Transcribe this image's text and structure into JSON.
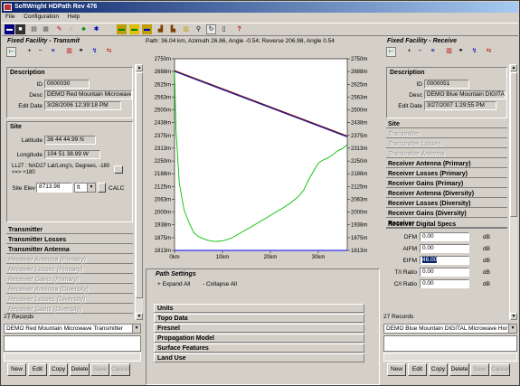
{
  "app": {
    "title": "SoftWright HDPath Rev 476"
  },
  "menu": [
    "File",
    "Configuration",
    "Help"
  ],
  "toolbar": {
    "icons": [
      "save-icon",
      "disk-icon",
      "print-icon",
      "report-icon",
      "edit-icon",
      "draw-icon",
      "chart-icon",
      "globe-icon",
      "map-icon",
      "map2-icon",
      "map3-icon",
      "terrain-icon",
      "zoom-icon",
      "refresh-icon",
      "copy-icon",
      "help-icon"
    ]
  },
  "left": {
    "panel_title": "Fixed Facility - Transmit",
    "description": {
      "header": "Description",
      "id_label": "ID",
      "id_value": "0000030",
      "desc_label": "Desc",
      "desc_value": "DEMO Red Mountain Microwave",
      "date_label": "Edit Date",
      "date_value": "3/28/2006 12:39:18 PM"
    },
    "site": {
      "header": "Site",
      "lat_label": "Latitude",
      "lat_value": "38 44 44.99 N",
      "lon_label": "Longitude",
      "lon_value": "104 51 38.99 W",
      "datum_text": "LL27 : NAD27 Lat/Long's, Degrees, -180 <=> +180",
      "elev_label": "Site Elev",
      "elev_value": "8713.98",
      "elev_unit": "ft",
      "calc_label": "CALC"
    },
    "sections": [
      {
        "label": "Transmitter",
        "enabled": true
      },
      {
        "label": "Transmitter Losses",
        "enabled": true
      },
      {
        "label": "Transmitter Antenna",
        "enabled": true
      },
      {
        "label": "Receiver Antenna (Primary)",
        "enabled": false
      },
      {
        "label": "Receiver Losses (Primary)",
        "enabled": false
      },
      {
        "label": "Receiver Gains (Primary)",
        "enabled": false
      },
      {
        "label": "Receiver Antenna (Diversity)",
        "enabled": false
      },
      {
        "label": "Receiver Losses (Diversity)",
        "enabled": false
      },
      {
        "label": "Receiver Gains (Diversity)",
        "enabled": false
      },
      {
        "label": "Receiver",
        "enabled": false
      },
      {
        "label": "Receiver Digital Specs",
        "enabled": false
      }
    ],
    "records_label": "27 Records",
    "selected_record": "DEMO Red Mountain Microwave Transmitter",
    "buttons": [
      {
        "label": "New",
        "enabled": true
      },
      {
        "label": "Edit",
        "enabled": true
      },
      {
        "label": "Copy",
        "enabled": true
      },
      {
        "label": "Delete",
        "enabled": true
      },
      {
        "label": "Save",
        "enabled": false
      },
      {
        "label": "Cancel",
        "enabled": false
      }
    ]
  },
  "right": {
    "panel_title": "Fixed Facility - Receive",
    "description": {
      "header": "Description",
      "id_label": "ID",
      "id_value": "0000051",
      "desc_label": "Desc",
      "desc_value": "DEMO Blue Mountain DIGITAL",
      "date_label": "Edit Date",
      "date_value": "3/27/2007 1:29:55 PM"
    },
    "site_header": "Site",
    "sections": [
      {
        "label": "Transmitter",
        "enabled": false
      },
      {
        "label": "Transmitter Losses",
        "enabled": false
      },
      {
        "label": "Transmitter Antenna",
        "enabled": false
      },
      {
        "label": "Receiver Antenna (Primary)",
        "enabled": true
      },
      {
        "label": "Receiver Losses (Primary)",
        "enabled": true
      },
      {
        "label": "Receiver Gains (Primary)",
        "enabled": true
      },
      {
        "label": "Receiver Antenna (Diversity)",
        "enabled": true
      },
      {
        "label": "Receiver Losses (Diversity)",
        "enabled": true
      },
      {
        "label": "Receiver Gains (Diversity)",
        "enabled": true
      },
      {
        "label": "Receiver",
        "enabled": true
      }
    ],
    "digital": {
      "header": "Receiver Digital Specs",
      "rows": [
        {
          "label": "DFM",
          "value": "0.00",
          "unit": "dB"
        },
        {
          "label": "AIFM",
          "value": "0.00",
          "unit": "dB"
        },
        {
          "label": "EIFM",
          "value": "46.00",
          "unit": "dB"
        },
        {
          "label": "T/I Ratio",
          "value": "0.00",
          "unit": "dB"
        },
        {
          "label": "C/I Ratio",
          "value": "0.00",
          "unit": "dB"
        }
      ]
    },
    "records_label": "27 Records",
    "selected_record": "DEMO Blue Mountain DIGITAL Microwave Hor",
    "buttons": [
      {
        "label": "New",
        "enabled": true
      },
      {
        "label": "Edit",
        "enabled": true
      },
      {
        "label": "Copy",
        "enabled": true
      },
      {
        "label": "Delete",
        "enabled": true
      },
      {
        "label": "Save",
        "enabled": false
      },
      {
        "label": "Cancel",
        "enabled": false
      }
    ]
  },
  "path_info": "Path: 36.04 km, Azimuth 26.86, Angle -0.54; Reverse 206.98, Angle 0.54",
  "chart_data": {
    "type": "line",
    "xlabel": "",
    "ylabel": "",
    "xlim": [
      0,
      36.04
    ],
    "ylim": [
      1813,
      2750
    ],
    "x_ticks": [
      "0km",
      "10km",
      "20km",
      "30km"
    ],
    "x_tick_values": [
      0,
      10,
      20,
      30
    ],
    "y_ticks": [
      "2750m",
      "2688m",
      "2625m",
      "2563m",
      "2500m",
      "2438m",
      "2375m",
      "2313m",
      "2250m",
      "2188m",
      "2125m",
      "2063m",
      "2000m",
      "1938m",
      "1875m",
      "1813m"
    ],
    "y_tick_values": [
      2750,
      2688,
      2625,
      2563,
      2500,
      2438,
      2375,
      2313,
      2250,
      2188,
      2125,
      2063,
      2000,
      1938,
      1875,
      1813
    ],
    "grid": true,
    "series": [
      {
        "name": "",
        "color": "#800000",
        "x": [
          0,
          36.04
        ],
        "y": [
          2692,
          2372
        ]
      },
      {
        "name": "",
        "color": "#2020a0",
        "x": [
          0,
          36.04
        ],
        "y": [
          2688,
          2368
        ]
      },
      {
        "name": "",
        "color": "#00c000",
        "x": [
          0,
          0.3,
          1,
          2,
          3,
          4,
          5,
          6,
          7,
          8,
          9,
          10,
          11,
          12,
          13,
          14,
          15,
          16,
          17,
          18,
          19,
          20,
          21,
          22,
          23,
          24,
          25,
          26,
          27,
          28,
          29,
          30,
          31,
          32,
          33,
          34,
          35,
          36.04
        ],
        "y": [
          2688,
          2400,
          2140,
          2010,
          1950,
          1900,
          1880,
          1870,
          1862,
          1858,
          1857,
          1860,
          1866,
          1875,
          1888,
          1902,
          1915,
          1928,
          1942,
          1956,
          1970,
          1984,
          1998,
          2012,
          2026,
          2042,
          2060,
          2080,
          2110,
          2160,
          2200,
          2240,
          2255,
          2265,
          2280,
          2300,
          2310,
          2330
        ]
      },
      {
        "name": "",
        "color": "#0000ff",
        "x": [
          0,
          36.04
        ],
        "y": [
          1813,
          1813
        ]
      }
    ]
  },
  "path_settings": {
    "title": "Path Settings",
    "expand_all": "+ Expand All",
    "collapse_all": "- Collapse All",
    "items": [
      "Units",
      "Topo Data",
      "Fresnel",
      "Propagation Model",
      "Surface Features",
      "Land Use"
    ]
  },
  "colors": {
    "titlebar_start": "#0a246a",
    "titlebar_end": "#a6caf0",
    "face": "#d4d0c8",
    "highlight": "#0a246a"
  }
}
